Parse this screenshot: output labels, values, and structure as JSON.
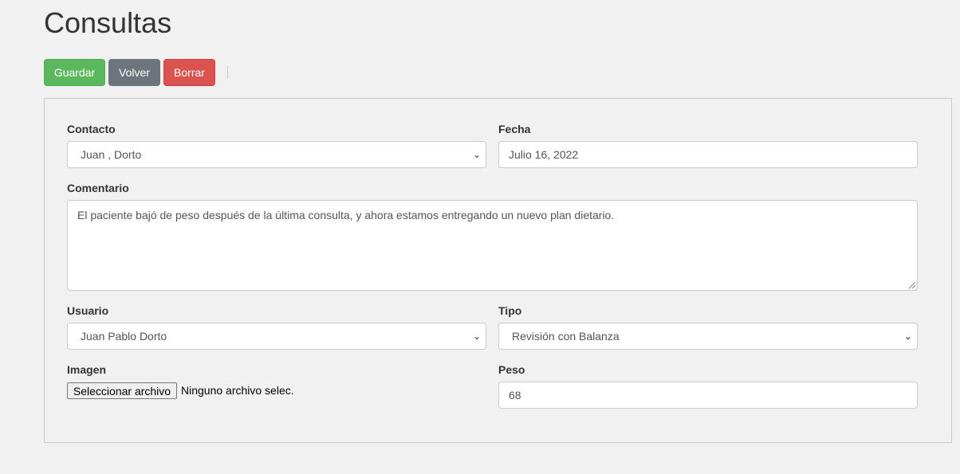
{
  "page": {
    "title": "Consultas"
  },
  "toolbar": {
    "save": "Guardar",
    "back": "Volver",
    "delete": "Borrar"
  },
  "colors": {
    "save": "#5cb85c",
    "back": "#6c757d",
    "delete": "#d9534f"
  },
  "form": {
    "contacto": {
      "label": "Contacto",
      "value": "Juan , Dorto"
    },
    "fecha": {
      "label": "Fecha",
      "value": "Julio 16, 2022"
    },
    "comentario": {
      "label": "Comentario",
      "value": "El paciente bajó de peso después de la última consulta, y ahora estamos entregando un nuevo plan dietario."
    },
    "usuario": {
      "label": "Usuario",
      "value": "Juan Pablo Dorto"
    },
    "tipo": {
      "label": "Tipo",
      "value": "Revisión con Balanza"
    },
    "imagen": {
      "label": "Imagen",
      "button": "Seleccionar archivo",
      "status": "Ninguno archivo selec."
    },
    "peso": {
      "label": "Peso",
      "value": "68"
    }
  }
}
